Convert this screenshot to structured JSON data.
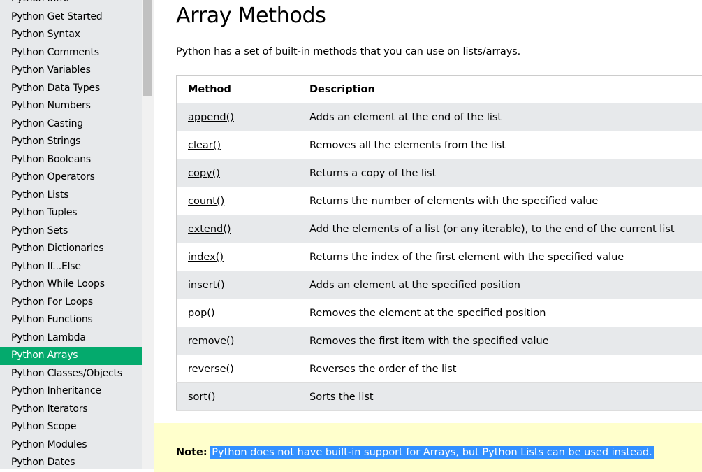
{
  "sidebar": {
    "items": [
      {
        "label": "Python Intro",
        "active": false
      },
      {
        "label": "Python Get Started",
        "active": false
      },
      {
        "label": "Python Syntax",
        "active": false
      },
      {
        "label": "Python Comments",
        "active": false
      },
      {
        "label": "Python Variables",
        "active": false
      },
      {
        "label": "Python Data Types",
        "active": false
      },
      {
        "label": "Python Numbers",
        "active": false
      },
      {
        "label": "Python Casting",
        "active": false
      },
      {
        "label": "Python Strings",
        "active": false
      },
      {
        "label": "Python Booleans",
        "active": false
      },
      {
        "label": "Python Operators",
        "active": false
      },
      {
        "label": "Python Lists",
        "active": false
      },
      {
        "label": "Python Tuples",
        "active": false
      },
      {
        "label": "Python Sets",
        "active": false
      },
      {
        "label": "Python Dictionaries",
        "active": false
      },
      {
        "label": "Python If...Else",
        "active": false
      },
      {
        "label": "Python While Loops",
        "active": false
      },
      {
        "label": "Python For Loops",
        "active": false
      },
      {
        "label": "Python Functions",
        "active": false
      },
      {
        "label": "Python Lambda",
        "active": false
      },
      {
        "label": "Python Arrays",
        "active": true
      },
      {
        "label": "Python Classes/Objects",
        "active": false
      },
      {
        "label": "Python Inheritance",
        "active": false
      },
      {
        "label": "Python Iterators",
        "active": false
      },
      {
        "label": "Python Scope",
        "active": false
      },
      {
        "label": "Python Modules",
        "active": false
      },
      {
        "label": "Python Dates",
        "active": false
      }
    ]
  },
  "main": {
    "title": "Array Methods",
    "intro": "Python has a set of built-in methods that you can use on lists/arrays.",
    "table": {
      "headers": [
        "Method",
        "Description"
      ],
      "rows": [
        {
          "method": "append()",
          "description": "Adds an element at the end of the list"
        },
        {
          "method": "clear()",
          "description": "Removes all the elements from the list"
        },
        {
          "method": "copy()",
          "description": "Returns a copy of the list"
        },
        {
          "method": "count()",
          "description": "Returns the number of elements with the specified value"
        },
        {
          "method": "extend()",
          "description": "Add the elements of a list (or any iterable), to the end of the current list"
        },
        {
          "method": "index()",
          "description": "Returns the index of the first element with the specified value"
        },
        {
          "method": "insert()",
          "description": "Adds an element at the specified position"
        },
        {
          "method": "pop()",
          "description": "Removes the element at the specified position"
        },
        {
          "method": "remove()",
          "description": "Removes the first item with the specified value"
        },
        {
          "method": "reverse()",
          "description": "Reverses the order of the list"
        },
        {
          "method": "sort()",
          "description": "Sorts the list"
        }
      ]
    },
    "note": {
      "label": "Note:",
      "text": "Python does not have built-in support for Arrays, but Python Lists can be used instead."
    }
  },
  "colors": {
    "sidebar_bg": "#e7e9eb",
    "active_item": "#04aa6d",
    "note_bg": "#ffffcc",
    "selection": "#3390ff"
  }
}
